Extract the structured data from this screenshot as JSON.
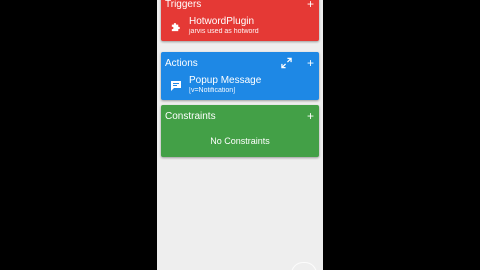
{
  "colors": {
    "trigger": "#e53935",
    "action": "#1e88e5",
    "constraint": "#43a047",
    "background": "#eeeeee",
    "outer": "#000000"
  },
  "triggers": {
    "title": "Triggers",
    "add_icon": "+",
    "item": {
      "icon": "puzzle-icon",
      "title": "HotwordPlugin",
      "subtitle": "jarvis used as hotword"
    }
  },
  "actions": {
    "title": "Actions",
    "expand_icon": "expand-icon",
    "add_icon": "+",
    "item": {
      "icon": "message-icon",
      "title": "Popup Message",
      "subtitle": "[v=Notification]"
    }
  },
  "constraints": {
    "title": "Constraints",
    "add_icon": "+",
    "empty_text": "No Constraints"
  }
}
